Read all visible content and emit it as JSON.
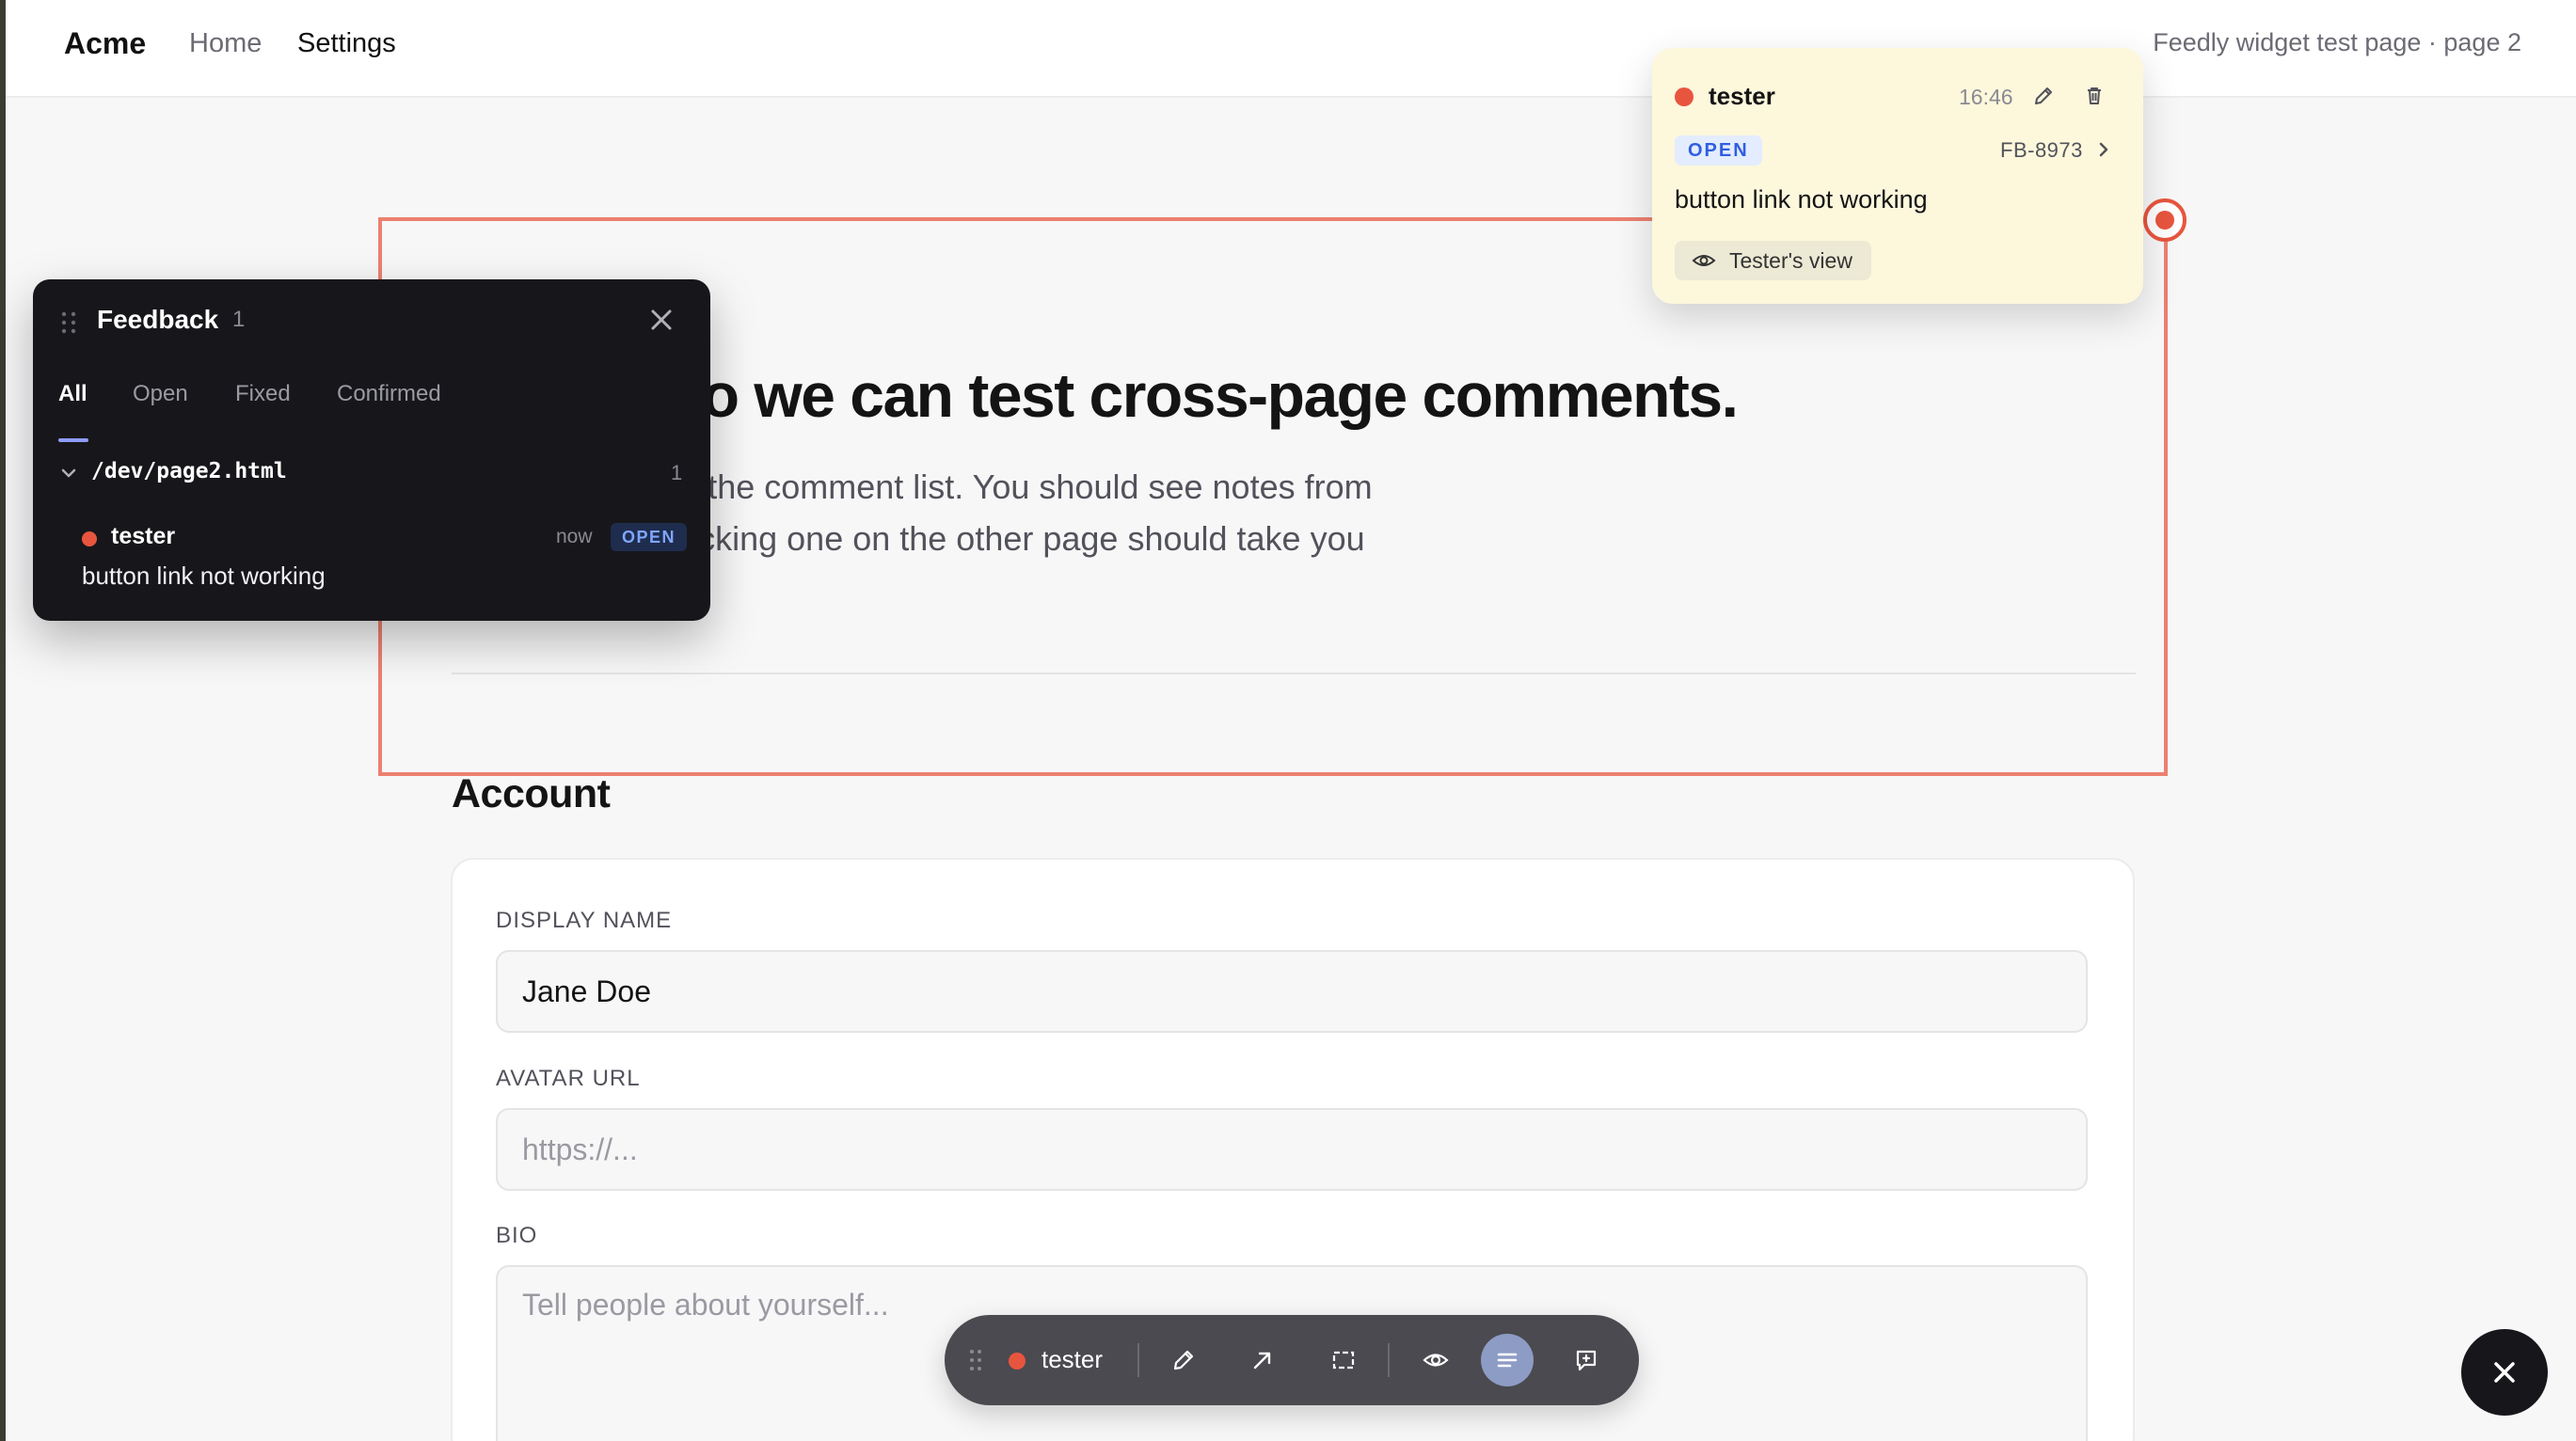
{
  "nav": {
    "brand": "Acme",
    "home": "Home",
    "settings": "Settings",
    "page_label": "Feedly widget test page · page 2"
  },
  "main": {
    "headline": "d page so we can test cross-page comments.",
    "subtext_line1": "here, then open the comment list. You should see notes from",
    "subtext_line2": "ped by URL. Clicking one on the other page should take you"
  },
  "account": {
    "title": "Account",
    "display_name_label": "DISPLAY NAME",
    "display_name_value": "Jane Doe",
    "avatar_label": "AVATAR URL",
    "avatar_placeholder": "https://...",
    "bio_label": "BIO",
    "bio_placeholder": "Tell people about yourself..."
  },
  "feedback_panel": {
    "title": "Feedback",
    "count": "1",
    "tabs": [
      {
        "label": "All"
      },
      {
        "label": "Open"
      },
      {
        "label": "Fixed"
      },
      {
        "label": "Confirmed"
      }
    ],
    "active_tab": "All",
    "group": {
      "path": "/dev/page2.html",
      "count": "1"
    },
    "comment": {
      "author": "tester",
      "time": "now",
      "status": "OPEN",
      "message": "button link not working",
      "dot_color": "#e8553e"
    }
  },
  "popover": {
    "author": "tester",
    "time": "16:46",
    "status": "OPEN",
    "ticket_id": "FB-8973",
    "message": "button link not working",
    "view_button": "Tester's view",
    "icons": [
      "pencil-icon",
      "trash-icon",
      "chevron-right-icon",
      "eye-icon"
    ]
  },
  "toolbar": {
    "user": "tester",
    "tools": [
      "pencil-icon",
      "arrow-icon",
      "rectangle-select-icon",
      "eye-icon",
      "list-icon",
      "comment-icon"
    ],
    "active_tool": "list-icon"
  },
  "colors": {
    "accent_red": "#e8553e",
    "highlight_border": "#ec8070",
    "popover_bg": "#fdf7dc",
    "panel_bg": "#17171b",
    "toolbar_bg": "#4a4a50"
  }
}
